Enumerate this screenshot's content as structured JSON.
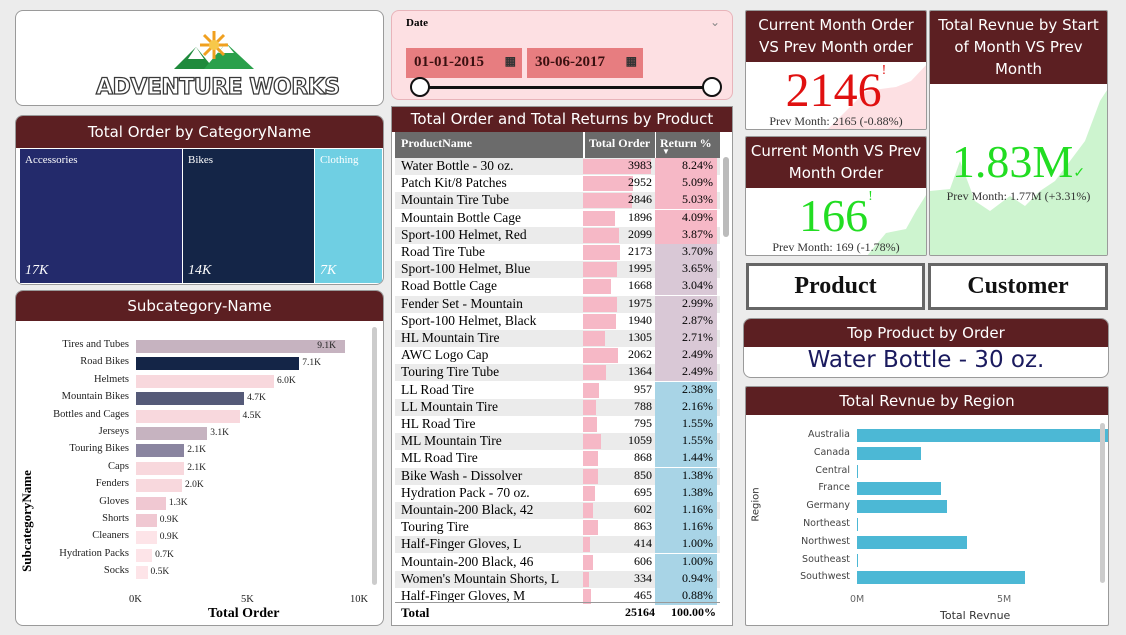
{
  "logo": {
    "text": "ADVENTURE WORKS"
  },
  "treemap": {
    "title": "Total Order by CategoryName",
    "cells": [
      {
        "label": "Accessories",
        "value": "17K",
        "color": "#232a6b"
      },
      {
        "label": "Bikes",
        "value": "14K",
        "color": "#142547"
      },
      {
        "label": "Clothing",
        "value": "7K",
        "color": "#6fcfe3"
      }
    ]
  },
  "subcategory": {
    "title": "Subcategory-Name",
    "ylabel": "SubcategoryName",
    "xlabel": "Total Order",
    "ticks": [
      "0K",
      "5K",
      "10K"
    ]
  },
  "date_slicer": {
    "label": "Date",
    "start": "01-01-2015",
    "end": "30-06-2017",
    "range_fraction": [
      0,
      1
    ]
  },
  "table": {
    "title": "Total Order and Total Returns by Product",
    "columns": [
      "ProductName",
      "Total Order",
      "Return %"
    ],
    "rows": [
      [
        "Water Bottle - 30 oz.",
        "3983",
        "8.24%"
      ],
      [
        "Patch Kit/8 Patches",
        "2952",
        "5.09%"
      ],
      [
        "Mountain Tire Tube",
        "2846",
        "5.03%"
      ],
      [
        "Mountain Bottle Cage",
        "1896",
        "4.09%"
      ],
      [
        "Sport-100 Helmet, Red",
        "2099",
        "3.87%"
      ],
      [
        "Road Tire Tube",
        "2173",
        "3.70%"
      ],
      [
        "Sport-100 Helmet, Blue",
        "1995",
        "3.65%"
      ],
      [
        "Road Bottle Cage",
        "1668",
        "3.04%"
      ],
      [
        "Fender Set - Mountain",
        "1975",
        "2.99%"
      ],
      [
        "Sport-100 Helmet, Black",
        "1940",
        "2.87%"
      ],
      [
        "HL Mountain Tire",
        "1305",
        "2.71%"
      ],
      [
        "AWC Logo Cap",
        "2062",
        "2.49%"
      ],
      [
        "Touring Tire Tube",
        "1364",
        "2.49%"
      ],
      [
        "LL Road Tire",
        "957",
        "2.38%"
      ],
      [
        "LL Mountain Tire",
        "788",
        "2.16%"
      ],
      [
        "HL Road Tire",
        "795",
        "1.55%"
      ],
      [
        "ML Mountain Tire",
        "1059",
        "1.55%"
      ],
      [
        "ML Road Tire",
        "868",
        "1.44%"
      ],
      [
        "Bike Wash - Dissolver",
        "850",
        "1.38%"
      ],
      [
        "Hydration Pack - 70 oz.",
        "695",
        "1.38%"
      ],
      [
        "Mountain-200 Black, 42",
        "602",
        "1.16%"
      ],
      [
        "Touring Tire",
        "863",
        "1.16%"
      ],
      [
        "Half-Finger Gloves, L",
        "414",
        "1.00%"
      ],
      [
        "Mountain-200 Black, 46",
        "606",
        "1.00%"
      ],
      [
        "Women's Mountain Shorts, L",
        "334",
        "0.94%"
      ],
      [
        "Half-Finger Gloves, M",
        "465",
        "0.88%"
      ]
    ],
    "total": {
      "label": "Total",
      "orders": "25164",
      "return": "100.00%"
    },
    "colors": {
      "order_bar": "#f6b8c6",
      "return_high": "#f6b8c6",
      "return_low": "#a8d4e6"
    }
  },
  "kpi_orders_1": {
    "title": "Current Month Order VS Prev Month order",
    "value": "2146",
    "sub": "Prev Month: 2165 (-0.88%)",
    "color": "#e01010"
  },
  "kpi_revenue": {
    "title": "Total Revnue by Start of Month VS Prev Month",
    "value": "1.83M",
    "sub": "Prev Month: 1.77M (+3.31%)",
    "color": "#22dd22"
  },
  "kpi_orders_2": {
    "title": "Current Month VS Prev Month Order",
    "value": "166",
    "sub": "Prev Month: 169 (-1.78%)",
    "color": "#22dd22"
  },
  "nav": {
    "product": "Product",
    "customer": "Customer"
  },
  "top_product": {
    "title": "Top Product by Order",
    "value": "Water Bottle - 30 oz."
  },
  "region": {
    "title": "Total Revnue by Region",
    "ylabel": "Region",
    "xlabel": "Total Revnue",
    "ticks": [
      "0M",
      "5M"
    ]
  },
  "chart_data": [
    {
      "type": "bar",
      "title": "Subcategory-Name",
      "xlabel": "Total Order",
      "ylabel": "SubcategoryName",
      "xlim": [
        0,
        10000
      ],
      "categories": [
        "Tires and Tubes",
        "Road Bikes",
        "Helmets",
        "Mountain Bikes",
        "Bottles and Cages",
        "Jerseys",
        "Touring Bikes",
        "Caps",
        "Fenders",
        "Gloves",
        "Shorts",
        "Cleaners",
        "Hydration Packs",
        "Socks"
      ],
      "values": [
        9100,
        7100,
        6000,
        4700,
        4500,
        3100,
        2100,
        2100,
        2000,
        1300,
        900,
        900,
        700,
        500
      ],
      "labels": [
        "9.1K",
        "7.1K",
        "6.0K",
        "4.7K",
        "4.5K",
        "3.1K",
        "2.1K",
        "2.1K",
        "2.0K",
        "1.3K",
        "0.9K",
        "0.9K",
        "0.7K",
        "0.5K"
      ],
      "colors": [
        "#c6b3c0",
        "#142547",
        "#f8d8dd",
        "#555a78",
        "#f8d8dd",
        "#c6b3c0",
        "#8a85a0",
        "#f8d8dd",
        "#f8d8dd",
        "#f0c8d2",
        "#f0c8d2",
        "#fde4e8",
        "#fde4e8",
        "#fde4e8"
      ]
    },
    {
      "type": "bar",
      "title": "Total Revnue by Region",
      "xlabel": "Total Revnue",
      "ylabel": "Region",
      "xlim": [
        0,
        10000000
      ],
      "categories": [
        "Australia",
        "Canada",
        "Central",
        "France",
        "Germany",
        "Northeast",
        "Northwest",
        "Southeast",
        "Southwest"
      ],
      "values": [
        9000000,
        2200000,
        10000,
        2900000,
        3100000,
        10000,
        3800000,
        10000,
        5800000
      ]
    }
  ]
}
